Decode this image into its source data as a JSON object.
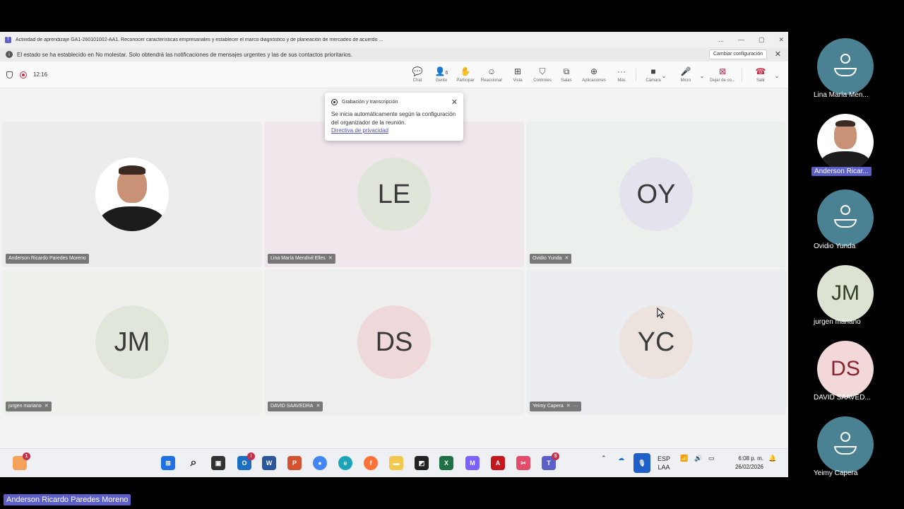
{
  "window": {
    "title": "Actividad de aprendizaje GA1-260101002-AA1. Reconocer características empresariales y establecer el marco diagnóstico y de planeación de mercadeo de acuerdo ...",
    "controls": [
      "...",
      "—",
      "▢",
      "✕"
    ]
  },
  "notice": {
    "text": "El estado se ha establecido en No molestar. Solo obtendrá las notificaciones de mensajes urgentes y las de sus contactos prioritarios.",
    "button": "Cambiar configuración"
  },
  "meeting": {
    "elapsed": "12:16"
  },
  "toolbar": {
    "items": [
      {
        "label": "Chat",
        "icon": "chat-icon"
      },
      {
        "label": "Gente",
        "icon": "people-icon",
        "count": "6"
      },
      {
        "label": "Participar",
        "icon": "raise-hand-icon"
      },
      {
        "label": "Reaccionar",
        "icon": "emoji-icon"
      },
      {
        "label": "Vista",
        "icon": "grid-icon"
      },
      {
        "label": "Controles",
        "icon": "shield-icon"
      },
      {
        "label": "Salas",
        "icon": "rooms-icon"
      },
      {
        "label": "Aplicaciones",
        "icon": "plus-icon"
      },
      {
        "label": "Más",
        "icon": "more-icon"
      },
      {
        "label": "Cámara",
        "icon": "camera-off-icon"
      },
      {
        "label": "Micro",
        "icon": "mic-icon"
      },
      {
        "label": "Dejar de co...",
        "icon": "stop-share-icon"
      },
      {
        "label": "Salir",
        "icon": "hangup-icon"
      }
    ]
  },
  "popup": {
    "title": "Grabación y transcripción",
    "body": "Se inicia automáticamente según la configuración del organizador de la reunión.",
    "link": "Directiva de privacidad"
  },
  "tiles": [
    {
      "name": "Anderson Ricardo Paredes Moreno",
      "initials": "",
      "bg": "#ececec",
      "avatarBg": "#ffffff"
    },
    {
      "name": "Lina María Mendivil Elles",
      "initials": "LE",
      "bg": "#efe7ec",
      "avatarBg": "#dfe5d8"
    },
    {
      "name": "Ovidio Yunda",
      "initials": "OY",
      "bg": "#ebf0ec",
      "avatarBg": "#e4e2ec"
    },
    {
      "name": "jurgen mariano",
      "initials": "JM",
      "bg": "#eef0ec",
      "avatarBg": "#e0e6da"
    },
    {
      "name": "DAVID SAAVEDRA",
      "initials": "DS",
      "bg": "#edeeed",
      "avatarBg": "#efd8da"
    },
    {
      "name": "Yeimy Capera",
      "initials": "YC",
      "bg": "#ecedf1",
      "avatarBg": "#ece3de"
    }
  ],
  "taskbar": {
    "lang": "ESP",
    "region": "LAA",
    "time": "6:08 p. m.",
    "date": "26/02/2026",
    "badges": {
      "left": "1",
      "outlook": "!",
      "teams": "3"
    }
  },
  "sidePanel": [
    {
      "name": "Lina María Men...",
      "type": "generic",
      "bg": "#4a8294"
    },
    {
      "name": "Anderson Ricar...",
      "type": "photo",
      "bg": "#ffffff",
      "highlight": true
    },
    {
      "name": "Ovidio Yunda",
      "type": "generic",
      "bg": "#4a8294"
    },
    {
      "name": "jurgen mariano",
      "type": "initials",
      "initials": "JM",
      "bg": "#dce3d3",
      "fg": "#2f3e25"
    },
    {
      "name": "DAVID SAAVED...",
      "type": "initials",
      "initials": "DS",
      "bg": "#f3d8da",
      "fg": "#8a2330"
    },
    {
      "name": "Yeimy Capera",
      "type": "generic",
      "bg": "#4a8294"
    }
  ],
  "footerTag": "Anderson Ricardo Paredes Moreno"
}
